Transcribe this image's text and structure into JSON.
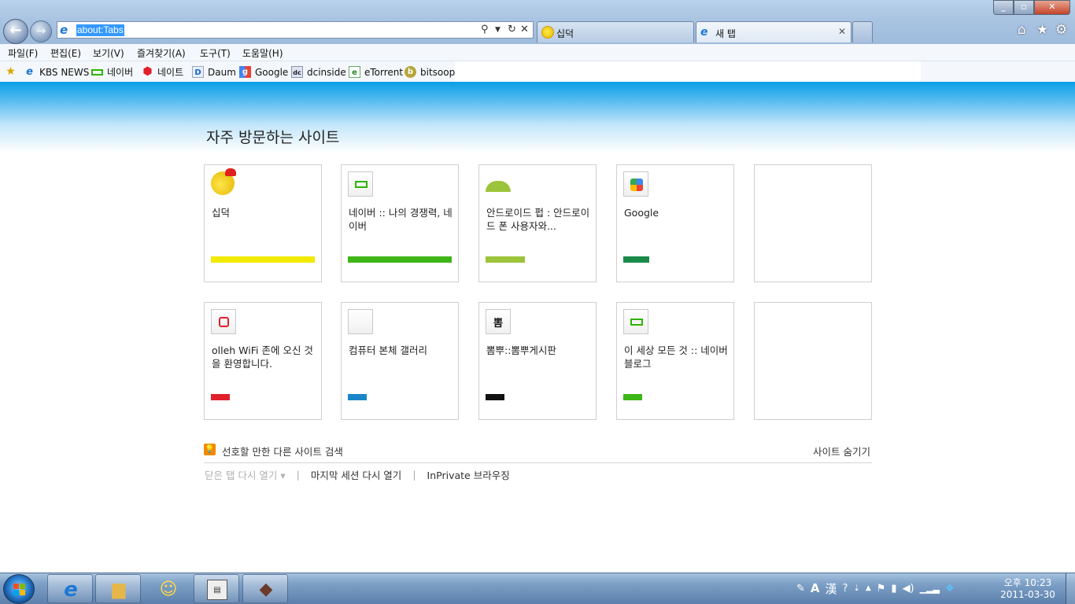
{
  "browser": {
    "address": "about:Tabs",
    "tabs": [
      {
        "label": "십덕"
      },
      {
        "label": "새 탭"
      }
    ]
  },
  "menu": [
    "파일(F)",
    "편집(E)",
    "보기(V)",
    "즐겨찾기(A)",
    "도구(T)",
    "도움말(H)"
  ],
  "favorites": [
    "KBS NEWS",
    "네이버",
    "네이트",
    "Daum",
    "Google",
    "dcinside",
    "eTorrent",
    "bitsoop"
  ],
  "page": {
    "title": "자주 방문하는 사이트",
    "tiles": [
      {
        "title": "십덕",
        "icon": "yellow-bird-icon",
        "bar_color": "#f2ea00",
        "bar_fill": 1.0
      },
      {
        "title": "네이버 :: 나의 경쟁력, 네이버",
        "icon": "naver-icon",
        "bar_color": "#3fb618",
        "bar_fill": 1.0
      },
      {
        "title": "안드로이드 펍 : 안드로이드 폰 사용자와...",
        "icon": "android-icon",
        "bar_color": "#9cc43a",
        "bar_fill": 0.38
      },
      {
        "title": "Google",
        "icon": "google-icon",
        "bar_color": "#1a8a4a",
        "bar_fill": 0.25
      },
      {
        "title": "",
        "icon": "",
        "bar_color": "",
        "bar_fill": 0
      },
      {
        "title": "olleh WiFi 존에 오신 것을 환영합니다.",
        "icon": "olleh-icon",
        "bar_color": "#e0202a",
        "bar_fill": 0.18
      },
      {
        "title": "컴퓨터 본체 갤러리",
        "icon": "blank-page-icon",
        "bar_color": "#1a86c8",
        "bar_fill": 0.18
      },
      {
        "title": "뽐뿌::뽐뿌게시판",
        "icon": "ppomppu-icon",
        "bar_color": "#111111",
        "bar_fill": 0.18
      },
      {
        "title": "이 세상 모든 것 :: 네이버 블로그",
        "icon": "naver-icon",
        "bar_color": "#3fb618",
        "bar_fill": 0.18
      },
      {
        "title": "",
        "icon": "",
        "bar_color": "",
        "bar_fill": 0
      }
    ],
    "discover": "선호할 만한 다른 사이트 검색",
    "hide_sites": "사이트 숨기기",
    "reopen_closed": "닫은 탭 다시 열기 ▾",
    "reopen_last": "마지막 세션 다시 열기",
    "inprivate": "InPrivate 브라우징",
    "separator": "|"
  },
  "taskbar": {
    "ime_mode": "A",
    "ime_hanja": "漢",
    "clock_time": "오후 10:23",
    "clock_date": "2011-03-30"
  }
}
